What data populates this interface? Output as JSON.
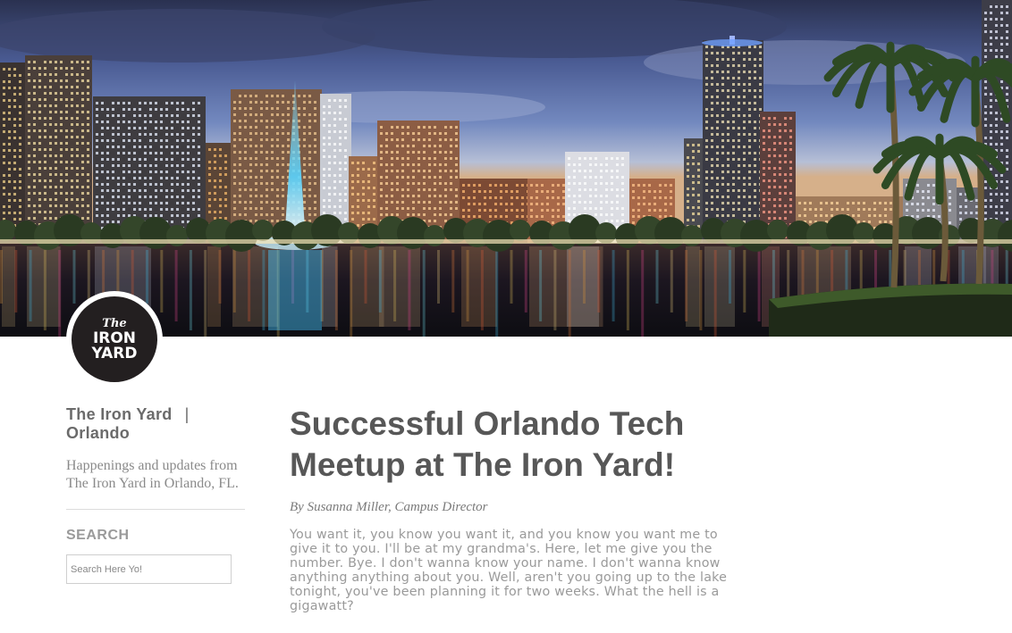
{
  "hero": {
    "image_name": "orlando-skyline-night-image"
  },
  "logo": {
    "line1": "The",
    "line2": "IRON",
    "line3": "YARD"
  },
  "sidebar": {
    "site_title": "The Iron Yard",
    "site_title_sep": "|",
    "site_title_line2": "Orlando",
    "tagline": "Happenings and updates from The Iron Yard in Orlando, FL.",
    "search_heading": "SEARCH",
    "search_placeholder": "Search Here Yo!"
  },
  "article": {
    "title": "Successful Orlando Tech Meetup at The Iron Yard!",
    "byline": "By Susanna Miller, Campus Director",
    "body": "You want it, you know you want it, and you know you want me to give it to you. I'll be at my grandma's. Here, let me give you the number. Bye. I don't wanna know your name. I don't wanna know anything anything about you. Well, aren't you going up to the lake tonight, you've been planning it for two weeks. What the hell is a gigawatt?"
  },
  "colors": {
    "title_gray": "#575757",
    "body_gray": "#9a9a9a",
    "logo_dark": "#231f20"
  }
}
